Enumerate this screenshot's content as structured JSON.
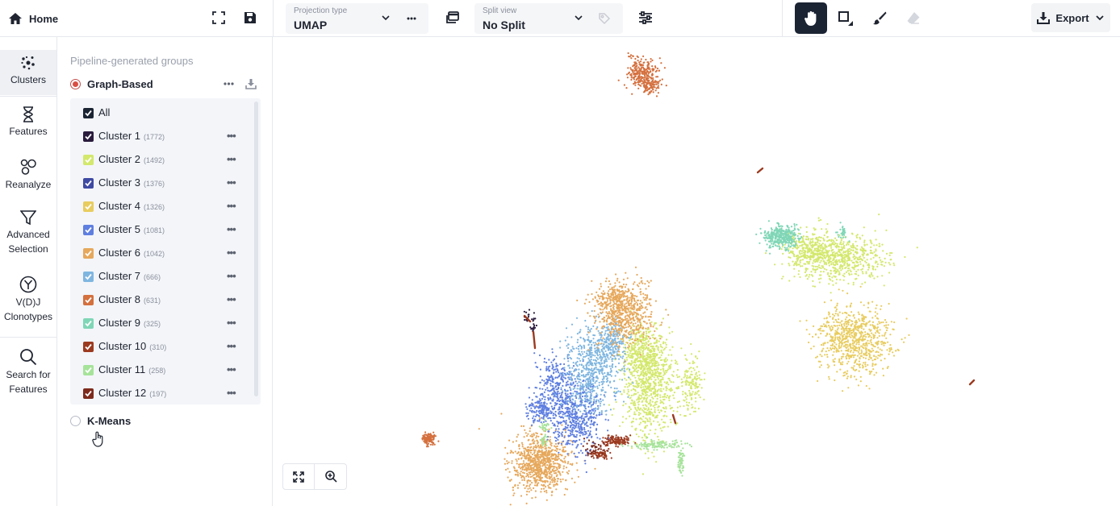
{
  "topbar": {
    "home_label": "Home",
    "projection": {
      "caption": "Projection type",
      "value": "UMAP"
    },
    "split": {
      "caption": "Split view",
      "value": "No Split"
    },
    "export_label": "Export",
    "tools": [
      "pan-hand",
      "box-select",
      "brush",
      "eraser"
    ],
    "active_tool": "pan-hand"
  },
  "rail": {
    "items": [
      {
        "label": "Clusters",
        "icon": "clusters-icon"
      },
      {
        "label": "Features",
        "icon": "hourglass-icon"
      },
      {
        "label": "Reanalyze",
        "icon": "bubbles-icon"
      },
      {
        "label": "Advanced Selection",
        "icon": "funnel-icon"
      },
      {
        "label": "V(D)J Clonotypes",
        "icon": "vdj-icon"
      },
      {
        "label": "Search for Features",
        "icon": "search-icon"
      }
    ],
    "active": "Clusters"
  },
  "panel": {
    "caption": "Pipeline-generated groups",
    "groups": [
      {
        "name": "Graph-Based",
        "selected": true
      },
      {
        "name": "K-Means",
        "selected": false
      }
    ],
    "all_label": "All",
    "clusters": [
      {
        "label": "Cluster 1",
        "count": "(1772)",
        "color": "#2a1b3d"
      },
      {
        "label": "Cluster 2",
        "count": "(1492)",
        "color": "#d3e86c"
      },
      {
        "label": "Cluster 3",
        "count": "(1376)",
        "color": "#3f4aa3"
      },
      {
        "label": "Cluster 4",
        "count": "(1326)",
        "color": "#e8cc5f"
      },
      {
        "label": "Cluster 5",
        "count": "(1081)",
        "color": "#5f7fe0"
      },
      {
        "label": "Cluster 6",
        "count": "(1042)",
        "color": "#e6a85c"
      },
      {
        "label": "Cluster 7",
        "count": "(666)",
        "color": "#7fb6e0"
      },
      {
        "label": "Cluster 8",
        "count": "(631)",
        "color": "#d4703e"
      },
      {
        "label": "Cluster 9",
        "count": "(325)",
        "color": "#7fd6b6"
      },
      {
        "label": "Cluster 10",
        "count": "(310)",
        "color": "#9c3a1f"
      },
      {
        "label": "Cluster 11",
        "count": "(258)",
        "color": "#a6e39a"
      },
      {
        "label": "Cluster 12",
        "count": "(197)",
        "color": "#7d2a1c"
      }
    ]
  }
}
